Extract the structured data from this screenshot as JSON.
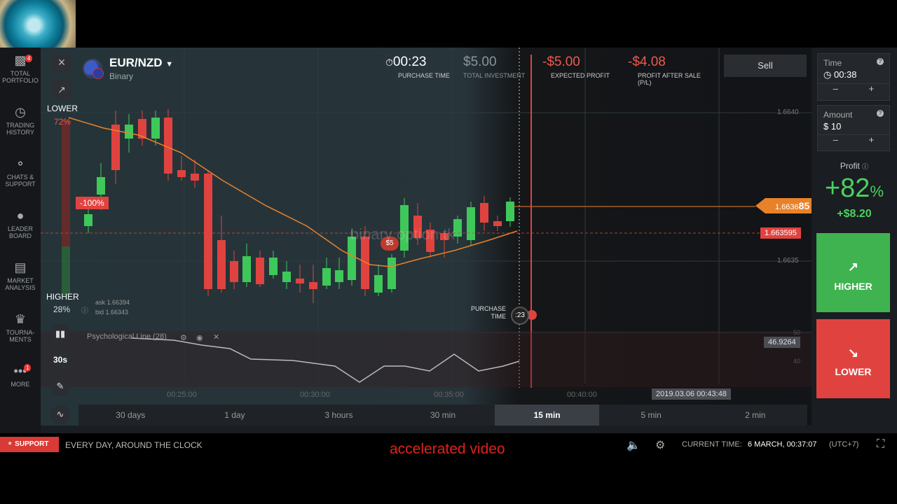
{
  "sidebar": {
    "items": [
      {
        "label": "TOTAL PORTFOLIO",
        "icon": "briefcase-icon",
        "badge": "4"
      },
      {
        "label": "TRADING HISTORY",
        "icon": "history-icon"
      },
      {
        "label": "CHATS & SUPPORT",
        "icon": "chat-icon"
      },
      {
        "label": "LEADER BOARD",
        "icon": "leaderboard-icon"
      },
      {
        "label": "MARKET ANALYSIS",
        "icon": "market-analysis-icon"
      },
      {
        "label": "TOURNA-MENTS",
        "icon": "trophy-icon"
      },
      {
        "label": "MORE",
        "icon": "more-icon",
        "badge": "1"
      }
    ]
  },
  "asset": {
    "name": "EUR/NZD",
    "type": "Binary"
  },
  "stats": {
    "purchase_time": {
      "value": "00:23",
      "label": "PURCHASE TIME"
    },
    "total_investment": {
      "value": "$5.00",
      "label": "TOTAL INVESTMENT"
    },
    "expected_profit": {
      "value": "-$5.00",
      "label": "EXPECTED PROFIT"
    },
    "profit_after_sale": {
      "value": "-$4.08",
      "label": "PROFIT AFTER SALE (P/L)"
    }
  },
  "sell_label": "Sell",
  "chart": {
    "lower_label": "LOWER",
    "lower_pct": "72%",
    "higher_label": "HIGHER",
    "higher_pct": "28%",
    "deal_marker": "-100%",
    "ask": "ask 1.66394",
    "bid": "bid 1.66343",
    "indicator": "Psychological Line (28)",
    "interval": "30s",
    "price_levels": [
      "1.6640",
      "1.6635"
    ],
    "current_price_main": "1.6636",
    "current_price_tail": "85",
    "strike_price": "1.663595",
    "indicator_value": "46.9264",
    "indicator_levels": [
      "50",
      "40"
    ],
    "purchase_time_label": "PURCHASE TIME",
    "purchase_countdown": ":23",
    "deal_amount": "$5",
    "watermark": "binary option tk",
    "time_labels": [
      "00:25:00",
      "00:30:00",
      "00:35:00",
      "00:40:00"
    ],
    "cursor_time": "2019.03.06 00:43:48",
    "colors": {
      "up": "#3fc85a",
      "down": "#e0433f",
      "ma": "#e8822a"
    }
  },
  "timeframes": [
    "30 days",
    "1 day",
    "3 hours",
    "30 min",
    "15 min",
    "5 min",
    "2 min"
  ],
  "active_timeframe": "15 min",
  "right_panel": {
    "time_label": "Time",
    "time_value": "00:38",
    "amount_label": "Amount",
    "amount_currency": "$",
    "amount_value": "10",
    "profit_label": "Profit",
    "profit_pct": "+82",
    "profit_pct_sign": "%",
    "profit_amount": "+$8.20",
    "higher_label": "HIGHER",
    "lower_label": "LOWER"
  },
  "status": {
    "support_label": "SUPPORT",
    "support_text": "EVERY DAY, AROUND THE CLOCK",
    "current_time_label": "CURRENT TIME:",
    "current_time_value": "6 MARCH, 00:37:07",
    "timezone": "(UTC+7)"
  },
  "overlay_text": "accelerated video"
}
